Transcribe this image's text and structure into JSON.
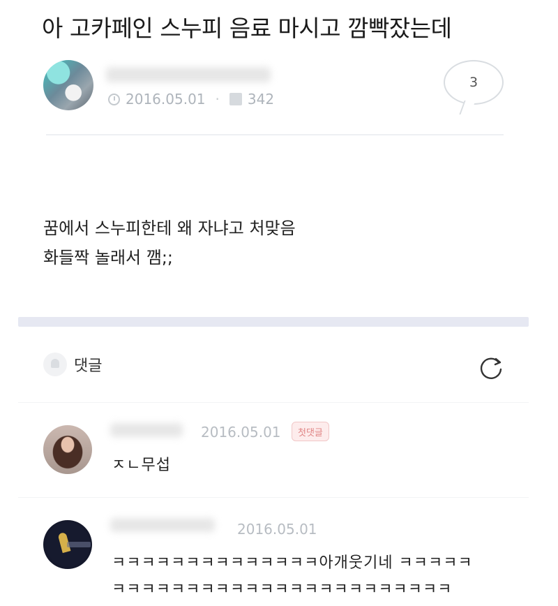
{
  "post": {
    "title": "아 고카페인 스누피 음료 마시고 깜빡잤는데",
    "date": "2016.05.01",
    "views": "342",
    "comment_count": "3",
    "body_lines": [
      "꿈에서 스누피한테 왜 자냐고 처맞음",
      "화들짝 놀래서 깸;;"
    ]
  },
  "comments_section": {
    "label": "댓글"
  },
  "comments": [
    {
      "date": "2016.05.01",
      "badge": "첫댓글",
      "text": "ㅈㄴ무섭"
    },
    {
      "date": "2016.05.01",
      "lines": [
        "ㅋㅋㅋㅋㅋㅋㅋㅋㅋㅋㅋㅋㅋㅋ아개웃기네 ㅋㅋㅋㅋㅋ",
        "ㅋㅋㅋㅋㅋㅋㅋㅋㅋㅋㅋㅋㅋㅋㅋㅋㅋㅋㅋㅋㅋㅋㅋ"
      ]
    }
  ],
  "colors": {
    "accent_band": "#e6e8f2",
    "badge_bg": "#fdecec",
    "badge_text": "#e08585"
  },
  "icons": [
    "clock-icon",
    "views-icon",
    "comment-bubble-icon",
    "bell-icon",
    "refresh-icon"
  ]
}
